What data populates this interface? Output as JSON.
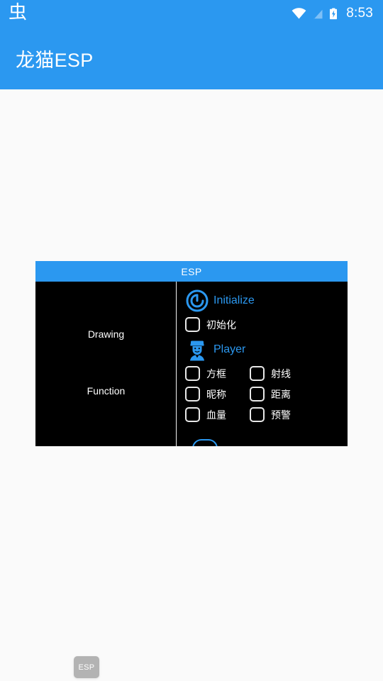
{
  "status_bar": {
    "notification_icon": "bug-glyph-icon",
    "notification_glyph": "虫",
    "icons": [
      "wifi-icon",
      "no-sim-signal-icon",
      "battery-charging-icon"
    ],
    "time": "8:53"
  },
  "app_bar": {
    "title": "龙猫ESP"
  },
  "esp_panel": {
    "title": "ESP",
    "nav": {
      "items": [
        {
          "label": "Drawing",
          "active": true
        },
        {
          "label": "Function",
          "active": false
        }
      ]
    },
    "sections": [
      {
        "icon": "initialize-circle-icon",
        "label": "Initialize",
        "rows": [
          [
            {
              "label": "初始化",
              "checked": false
            }
          ]
        ]
      },
      {
        "icon": "player-avatar-icon",
        "label": "Player",
        "rows": [
          [
            {
              "label": "方框",
              "checked": false
            },
            {
              "label": "射线",
              "checked": false
            }
          ],
          [
            {
              "label": "昵称",
              "checked": false
            },
            {
              "label": "距离",
              "checked": false
            }
          ],
          [
            {
              "label": "血量",
              "checked": false
            },
            {
              "label": "预警",
              "checked": false
            }
          ]
        ]
      }
    ]
  },
  "floating_button": {
    "label": "ESP"
  },
  "colors": {
    "accent_blue": "#2b98f0",
    "panel_background": "#000000",
    "page_background": "#fafafa",
    "fab_gray": "#b3b3b3",
    "checkbox_border": "#e8e8e8"
  }
}
